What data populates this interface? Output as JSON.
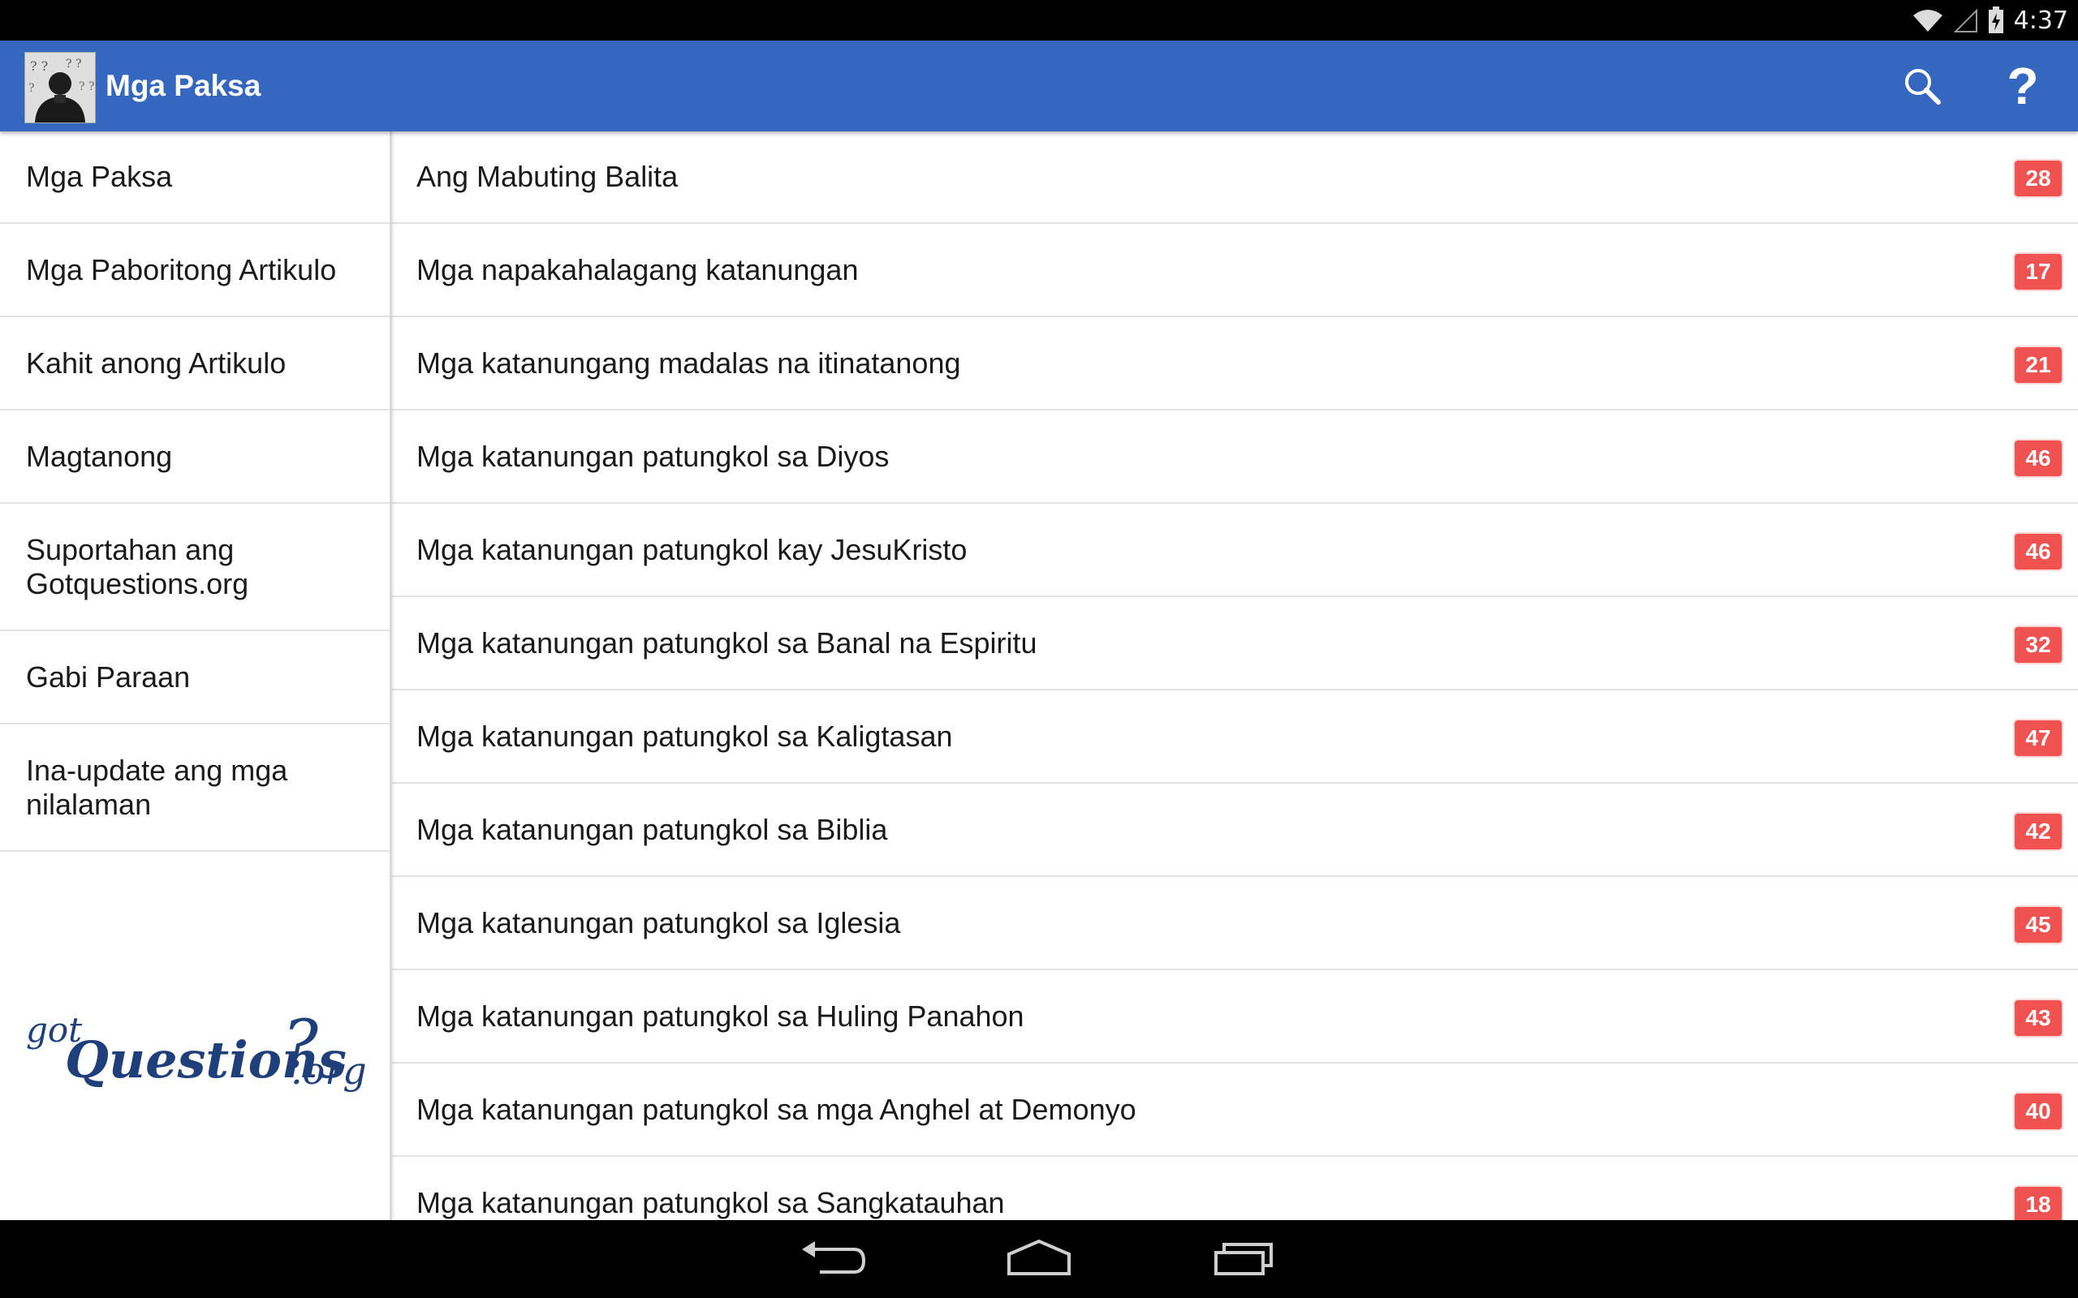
{
  "status_bar": {
    "time": "4:37",
    "icons": [
      "wifi-icon",
      "signal-icon",
      "battery-charging-icon"
    ]
  },
  "app_bar": {
    "title": "Mga Paksa",
    "avatar": "question-person-avatar",
    "actions": [
      "search-icon",
      "help-icon"
    ],
    "color": "#3567bf"
  },
  "sidebar": {
    "items": [
      {
        "label": "Mga Paksa"
      },
      {
        "label": "Mga Paboritong Artikulo"
      },
      {
        "label": "Kahit anong Artikulo"
      },
      {
        "label": "Magtanong"
      },
      {
        "label": "Suportahan ang Gotquestions.org"
      },
      {
        "label": "Gabi Paraan"
      },
      {
        "label": "Ina-update ang mga nilalaman"
      }
    ],
    "logo": {
      "part1": "got",
      "part2": "Questions",
      "part3": "?",
      "part4": ".org"
    }
  },
  "main": {
    "badge_color": "#f05252",
    "rows": [
      {
        "label": "Ang Mabuting Balita",
        "count": "28"
      },
      {
        "label": "Mga napakahalagang katanungan",
        "count": "17"
      },
      {
        "label": "Mga katanungang madalas na itinatanong",
        "count": "21"
      },
      {
        "label": "Mga katanungan patungkol sa Diyos",
        "count": "46"
      },
      {
        "label": "Mga katanungan patungkol kay JesuKristo",
        "count": "46"
      },
      {
        "label": "Mga katanungan patungkol sa Banal na Espiritu",
        "count": "32"
      },
      {
        "label": "Mga katanungan patungkol sa Kaligtasan",
        "count": "47"
      },
      {
        "label": "Mga katanungan patungkol sa Biblia",
        "count": "42"
      },
      {
        "label": "Mga katanungan patungkol sa Iglesia",
        "count": "45"
      },
      {
        "label": "Mga katanungan patungkol sa Huling Panahon",
        "count": "43"
      },
      {
        "label": "Mga katanungan patungkol sa mga Anghel at Demonyo",
        "count": "40"
      },
      {
        "label": "Mga katanungan patungkol sa Sangkatauhan",
        "count": "18"
      }
    ]
  },
  "nav_bar": {
    "buttons": [
      "back-icon",
      "home-icon",
      "recent-apps-icon"
    ]
  }
}
